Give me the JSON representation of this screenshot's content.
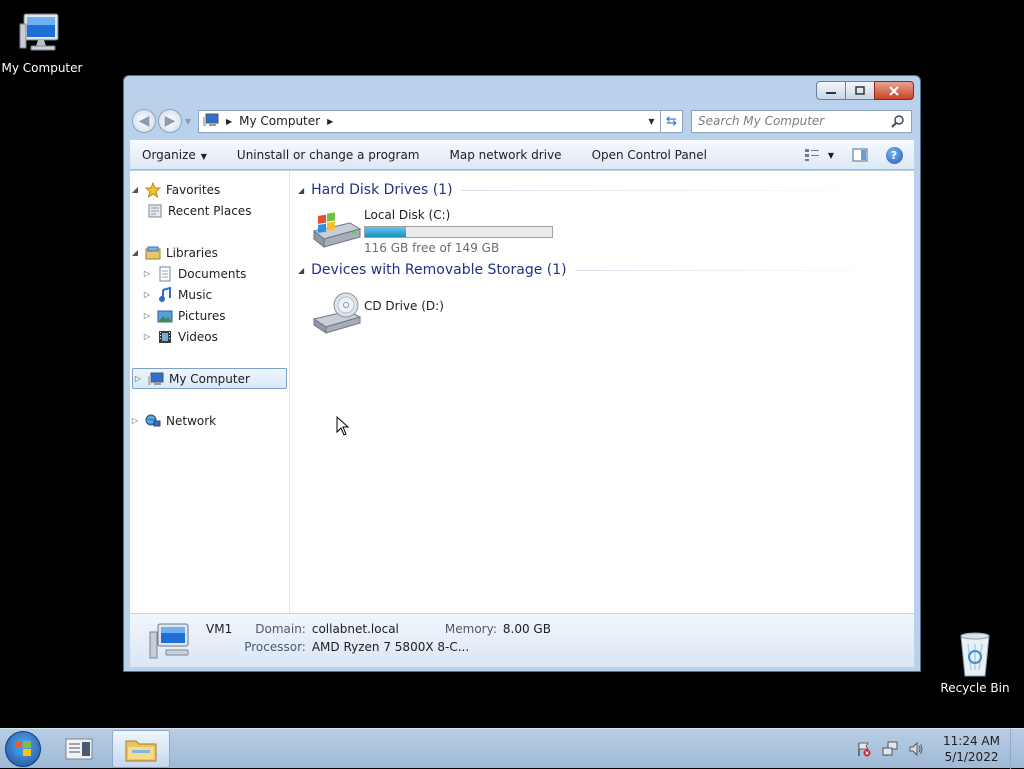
{
  "desktop": {
    "icons": [
      {
        "label": "My Computer",
        "icon": "computer-icon"
      },
      {
        "label": "Recycle Bin",
        "icon": "recycle-bin-icon"
      }
    ]
  },
  "window": {
    "address": {
      "crumbs": [
        "My Computer"
      ]
    },
    "search": {
      "placeholder": "Search My Computer"
    },
    "commands": {
      "organize": "Organize",
      "uninstall": "Uninstall or change a program",
      "map_drive": "Map network drive",
      "control_panel": "Open Control Panel"
    },
    "nav": {
      "favorites": "Favorites",
      "recent_places": "Recent Places",
      "libraries": "Libraries",
      "documents": "Documents",
      "music": "Music",
      "pictures": "Pictures",
      "videos": "Videos",
      "my_computer": "My Computer",
      "network": "Network"
    },
    "groups": {
      "hdd": {
        "title": "Hard Disk Drives (1)",
        "drive": {
          "name": "Local Disk (C:)",
          "free_text": "116 GB free of 149 GB",
          "used_fraction": 0.22
        }
      },
      "removable": {
        "title": "Devices with Removable Storage (1)",
        "drive": {
          "name": "CD Drive (D:)"
        }
      }
    },
    "details": {
      "name": "VM1",
      "domain_label": "Domain:",
      "domain": "collabnet.local",
      "memory_label": "Memory:",
      "memory": "8.00 GB",
      "processor_label": "Processor:",
      "processor": "AMD Ryzen 7 5800X 8-C..."
    }
  },
  "taskbar": {
    "time": "11:24 AM",
    "date": "5/1/2022"
  }
}
